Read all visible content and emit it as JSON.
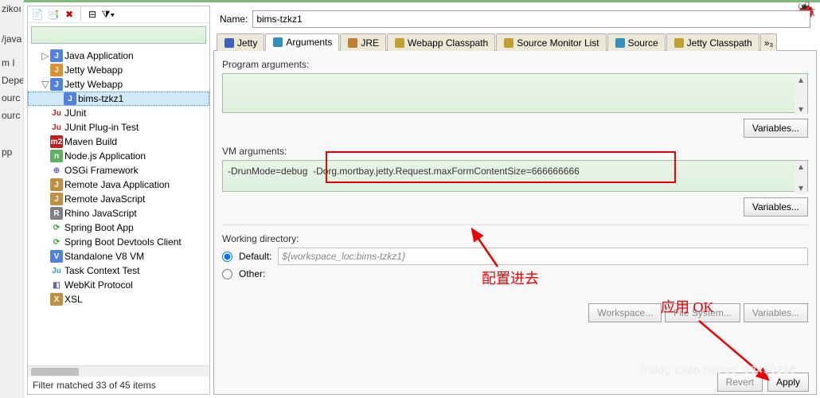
{
  "left_strip": [
    "zikoı",
    "",
    "",
    "/java",
    "",
    "m I",
    "Depe",
    "ourc",
    "ourc",
    "",
    "",
    "",
    "pp"
  ],
  "name_label": "Name:",
  "name_value": "bims-tzkz1",
  "tabs": [
    {
      "label": "Jetty",
      "color": "#4060c0"
    },
    {
      "label": "Arguments",
      "color": "#3090c0"
    },
    {
      "label": "JRE",
      "color": "#c08030"
    },
    {
      "label": "Webapp Classpath",
      "color": "#c0a030"
    },
    {
      "label": "Source Monitor List",
      "color": "#c0a030"
    },
    {
      "label": "Source",
      "color": "#3090c0"
    },
    {
      "label": "Jetty Classpath",
      "color": "#c0a030"
    }
  ],
  "active_tab": 1,
  "tabs_overflow": "»₃",
  "program_args_label": "Program arguments:",
  "program_args_value": "",
  "variables_label": "Variables...",
  "vm_args_label": "VM arguments:",
  "vm_args_value": "-DrunMode=debug  -Dorg.mortbay.jetty.Request.maxFormContentSize=666666666",
  "wd_label": "Working directory:",
  "wd_default_label": "Default:",
  "wd_default_value": "${workspace_loc:bims-tzkz1}",
  "wd_other_label": "Other:",
  "wd_buttons": [
    "Workspace...",
    "File System...",
    "Variables..."
  ],
  "footer_buttons": [
    "Revert",
    "Apply"
  ],
  "tree": [
    {
      "indent": 1,
      "expander": "▷",
      "icon": "J",
      "icon_bg": "#5080e0",
      "label": "Java Application"
    },
    {
      "indent": 1,
      "expander": "",
      "icon": "J",
      "icon_bg": "#e09030",
      "label": "Jetty Webapp"
    },
    {
      "indent": 1,
      "expander": "▽",
      "icon": "J",
      "icon_bg": "#5080e0",
      "label": "Jetty Webapp"
    },
    {
      "indent": 2,
      "expander": "",
      "icon": "J",
      "icon_bg": "#5080e0",
      "label": "bims-tzkz1",
      "selected": true
    },
    {
      "indent": 1,
      "expander": "",
      "icon": "Ju",
      "icon_bg": "#fff",
      "fg": "#c02020",
      "label": "JUnit"
    },
    {
      "indent": 1,
      "expander": "",
      "icon": "Ju",
      "icon_bg": "#fff",
      "fg": "#c02020",
      "label": "JUnit Plug-in Test"
    },
    {
      "indent": 1,
      "expander": "",
      "icon": "m2",
      "icon_bg": "#c02020",
      "label": "Maven Build"
    },
    {
      "indent": 1,
      "expander": "",
      "icon": "n",
      "icon_bg": "#60b060",
      "label": "Node.js Application"
    },
    {
      "indent": 1,
      "expander": "",
      "icon": "⊕",
      "icon_bg": "#fff",
      "fg": "#8060c0",
      "label": "OSGi Framework"
    },
    {
      "indent": 1,
      "expander": "",
      "icon": "J",
      "icon_bg": "#c09040",
      "label": "Remote Java Application"
    },
    {
      "indent": 1,
      "expander": "",
      "icon": "J",
      "icon_bg": "#c09040",
      "label": "Remote JavaScript"
    },
    {
      "indent": 1,
      "expander": "",
      "icon": "R",
      "icon_bg": "#808080",
      "label": "Rhino JavaScript"
    },
    {
      "indent": 1,
      "expander": "",
      "icon": "⟳",
      "icon_bg": "#fff",
      "fg": "#40a040",
      "label": "Spring Boot App"
    },
    {
      "indent": 1,
      "expander": "",
      "icon": "⟳",
      "icon_bg": "#fff",
      "fg": "#40a040",
      "label": "Spring Boot Devtools Client"
    },
    {
      "indent": 1,
      "expander": "",
      "icon": "V",
      "icon_bg": "#5080e0",
      "label": "Standalone V8 VM"
    },
    {
      "indent": 1,
      "expander": "",
      "icon": "Ju",
      "icon_bg": "#fff",
      "fg": "#30a0c0",
      "label": "Task Context Test"
    },
    {
      "indent": 1,
      "expander": "",
      "icon": "◧",
      "icon_bg": "#fff",
      "fg": "#6060c0",
      "label": "WebKit Protocol"
    },
    {
      "indent": 1,
      "expander": "",
      "icon": "X",
      "icon_bg": "#c09040",
      "label": "XSL"
    }
  ],
  "filter_status": "Filter matched 33 of 45 items",
  "annotations": {
    "config": "配置进去",
    "apply_ok": "应用 OK"
  },
  "watermark": "//blog.csdn.net/qq_33450218"
}
